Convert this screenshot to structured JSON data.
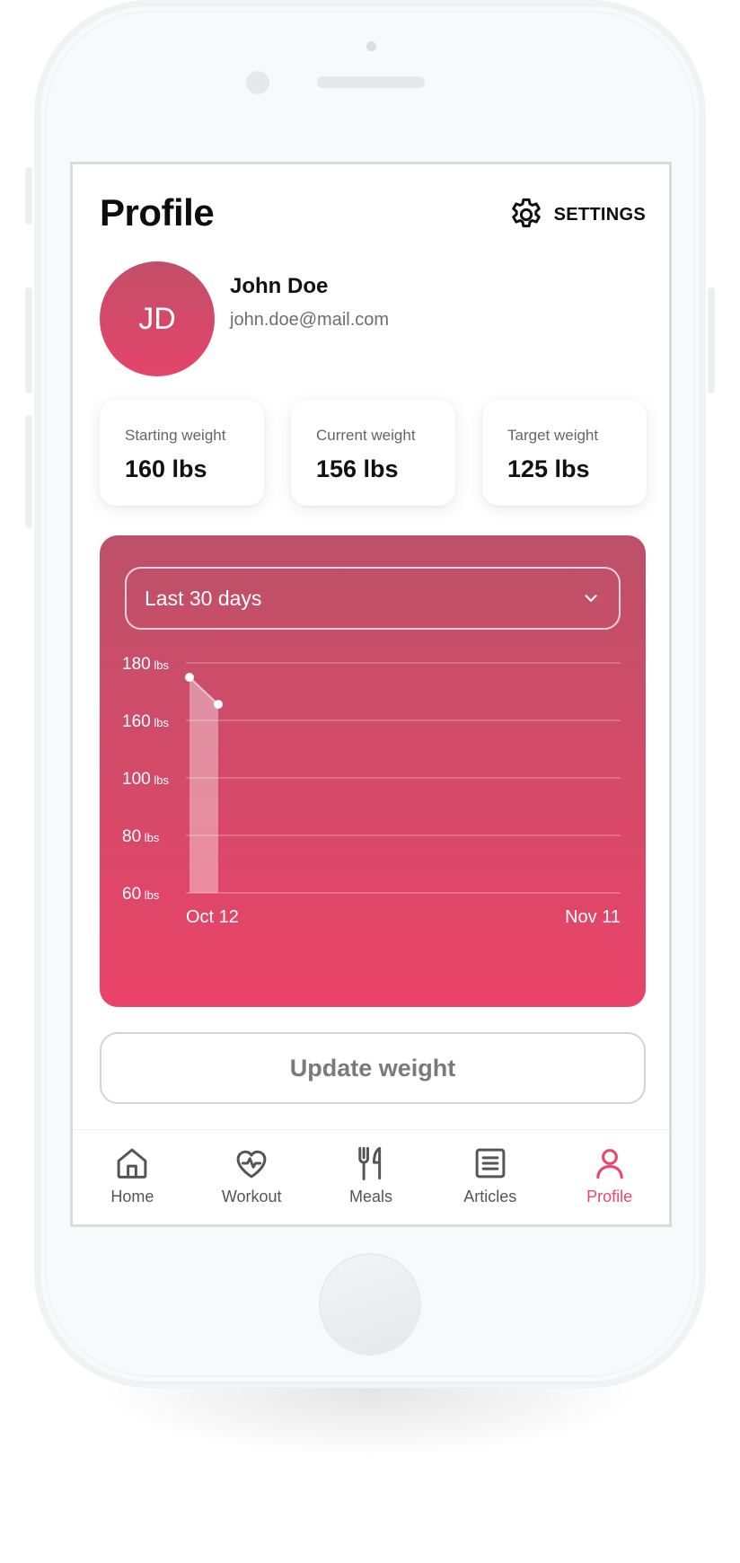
{
  "header": {
    "title": "Profile",
    "settings_label": "SETTINGS",
    "settings_icon": "gear-icon"
  },
  "user": {
    "initials": "JD",
    "name": "John Doe",
    "email": "john.doe@mail.com"
  },
  "stats": [
    {
      "label": "Starting weight",
      "value": "160 lbs"
    },
    {
      "label": "Current weight",
      "value": "156 lbs"
    },
    {
      "label": "Target weight",
      "value": "125 lbs"
    }
  ],
  "period_select": {
    "selected": "Last 30 days",
    "icon": "chevron-down-icon"
  },
  "chart_data": {
    "type": "area",
    "y_ticks": [
      {
        "value": "180",
        "unit": "lbs"
      },
      {
        "value": "160",
        "unit": "lbs"
      },
      {
        "value": "100",
        "unit": "lbs"
      },
      {
        "value": "80",
        "unit": "lbs"
      },
      {
        "value": "60",
        "unit": "lbs"
      }
    ],
    "x_labels": [
      "Oct 12",
      "Nov 11"
    ],
    "grid": true,
    "points": [
      {
        "day": 1,
        "tick_position": 0.25
      },
      {
        "day": 2,
        "tick_position": 0.72
      }
    ],
    "x_days": 30,
    "fill_color": "#ffffff",
    "background_gradient": [
      "#bd5169",
      "#ea4369"
    ]
  },
  "actions": {
    "update_weight": "Update weight"
  },
  "tabs": [
    {
      "label": "Home",
      "icon": "home-icon",
      "active": false
    },
    {
      "label": "Workout",
      "icon": "heart-pulse-icon",
      "active": false
    },
    {
      "label": "Meals",
      "icon": "fork-knife-icon",
      "active": false
    },
    {
      "label": "Articles",
      "icon": "article-icon",
      "active": false
    },
    {
      "label": "Profile",
      "icon": "user-icon",
      "active": true
    }
  ],
  "colors": {
    "accent": "#e8486b",
    "inactive_icon": "#555555"
  }
}
